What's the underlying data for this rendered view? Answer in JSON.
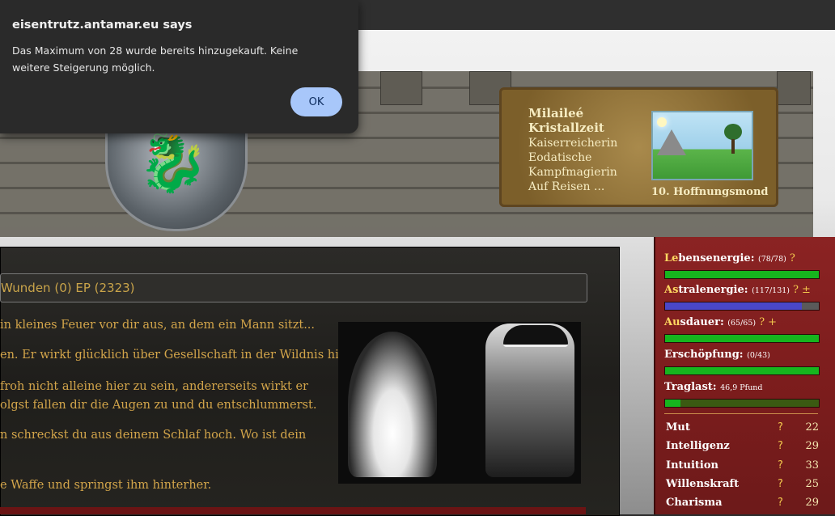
{
  "dialog": {
    "title": "eisentrutz.antamar.eu says",
    "message": "Das Maximum von 28 wurde bereits hinzugekauft. Keine weitere Steigerung möglich.",
    "ok_label": "OK"
  },
  "character": {
    "name_line1": "Milaileé",
    "name_line2": "Kristallzeit",
    "line3": "Kaiserreicherin",
    "line4": "Eodatische",
    "line5": "Kampfmagierin",
    "line6": "Auf Reisen ...",
    "date": "10. Hoffnungsmond"
  },
  "panel": {
    "header": "Wunden (0) EP (2323)",
    "story": [
      "in kleines Feuer vor dir aus, an dem ein Mann sitzt...",
      "en. Er wirkt glücklich über Gesellschaft in der Wildnis hier.",
      "froh nicht alleine hier zu sein, andererseits wirkt er",
      "olgst fallen dir die Augen zu und du entschlummerst.",
      "n schreckst du aus deinem Schlaf hoch. Wo ist dein",
      "e Waffe und springst ihm hinterher."
    ]
  },
  "stats": {
    "lebensenergie": {
      "hl": "Le",
      "rest": "bensenergie:",
      "value": "(78/78)",
      "q": "?",
      "fill": 1.0
    },
    "astralenergie": {
      "hl": "As",
      "rest": "tralenergie:",
      "value": "(117/131)",
      "q": "?",
      "extra": "±",
      "fill": 0.89
    },
    "ausdauer": {
      "hl": "Au",
      "rest": "sdauer:",
      "value": "(65/65)",
      "q": "?",
      "extra": "+",
      "fill": 1.0
    },
    "erschoepfung": {
      "label": "Erschöpfung:",
      "value": "(0/43)",
      "fill": 1.0
    },
    "traglast": {
      "label": "Traglast:",
      "value": "46,9 Pfund",
      "fill": 0.1
    }
  },
  "attributes": [
    {
      "name": "Mut",
      "q": "?",
      "value": "22"
    },
    {
      "name": "Intelligenz",
      "q": "?",
      "value": "29"
    },
    {
      "name": "Intuition",
      "q": "?",
      "value": "33"
    },
    {
      "name": "Willenskraft",
      "q": "?",
      "value": "25"
    },
    {
      "name": "Charisma",
      "q": "?",
      "value": "29"
    }
  ],
  "colors": {
    "bar_green": "#16b51e",
    "bar_blue": "#4a47c8",
    "bar_dark_green": "#2c6b16",
    "panel_red": "#8b2323"
  }
}
